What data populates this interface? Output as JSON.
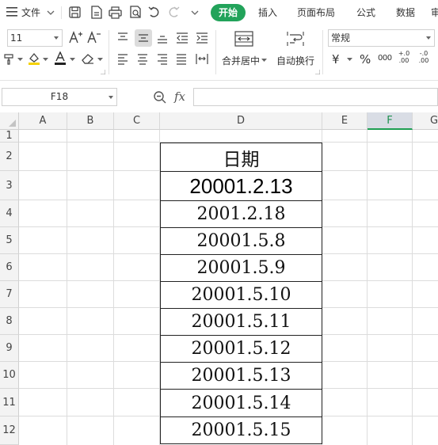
{
  "menubar": {
    "file_label": "文件",
    "tabs": [
      "开始",
      "插入",
      "页面布局",
      "公式",
      "数据",
      "审"
    ],
    "active_tab_color": "#22a35a"
  },
  "ribbon": {
    "font_size": "11",
    "merge_center_label": "合并居中",
    "wrap_text_label": "自动换行",
    "number_format": "常规",
    "currency_symbol": "¥",
    "percent_symbol": "%",
    "thousands_symbol": "000",
    "inc_decimal": "+.0 .00",
    "dec_decimal": "-.0 .00"
  },
  "formula_bar": {
    "name_box": "F18",
    "zoom_icon": "magnifier-icon",
    "fx_label": "fx",
    "formula_value": ""
  },
  "sheet": {
    "columns": [
      "A",
      "B",
      "C",
      "D",
      "E",
      "F",
      "G"
    ],
    "selected_column": "F",
    "rows": [
      "1",
      "2",
      "3",
      "4",
      "5",
      "6",
      "7",
      "8",
      "9",
      "10",
      "11",
      "12"
    ],
    "d_column": {
      "header": "日期",
      "values": [
        "20001.2.13",
        "2001.2.18",
        "20001.5.8",
        "20001.5.9",
        "20001.5.10",
        "20001.5.11",
        "20001.5.12",
        "20001.5.13",
        "20001.5.14",
        "20001.5.15"
      ]
    },
    "selection_color": "#1e9e52"
  }
}
